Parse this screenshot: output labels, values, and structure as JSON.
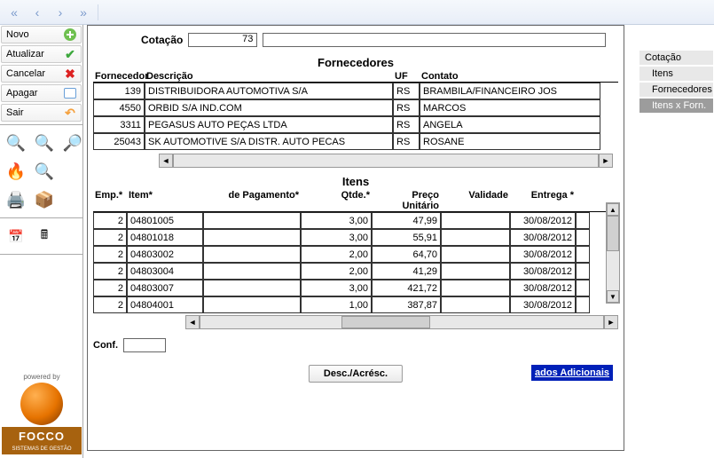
{
  "leftButtons": {
    "novo": "Novo",
    "atualizar": "Atualizar",
    "cancelar": "Cancelar",
    "apagar": "Apagar",
    "sair": "Sair"
  },
  "logo": {
    "poweredBy": "powered by",
    "name": "FOCCO",
    "sub": "SISTEMAS DE GESTÃO"
  },
  "rightMenu": {
    "cotacao": "Cotação",
    "itens": "Itens",
    "fornecedores": "Fornecedores",
    "itensxforn": "Itens x Forn."
  },
  "cotacao": {
    "label": "Cotação",
    "numero": "73"
  },
  "fornecedores": {
    "title": "Fornecedores",
    "headers": {
      "forn": "Fornecedor",
      "desc": "Descrição",
      "uf": "UF",
      "cont": "Contato"
    },
    "rows": [
      {
        "forn": "139",
        "desc": "DISTRIBUIDORA AUTOMOTIVA S/A",
        "uf": "RS",
        "cont": "BRAMBILA/FINANCEIRO JOS"
      },
      {
        "forn": "4550",
        "desc": "ORBID S/A IND.COM",
        "uf": "RS",
        "cont": "MARCOS"
      },
      {
        "forn": "3311",
        "desc": "PEGASUS AUTO PEÇAS LTDA",
        "uf": "RS",
        "cont": "ANGELA"
      },
      {
        "forn": "25043",
        "desc": "SK AUTOMOTIVE S/A DISTR. AUTO PECAS",
        "uf": "RS",
        "cont": "ROSANE"
      }
    ]
  },
  "itens": {
    "title": "Itens",
    "headers": {
      "emp": "Emp.*",
      "item": "Item*",
      "pag": "de Pagamento*",
      "qtde": "Qtde.*",
      "preco": "Preço Unitário",
      "val": "Validade",
      "ent": "Entrega *",
      "extra": ""
    },
    "rows": [
      {
        "emp": "2",
        "item": "04801005",
        "pag": "",
        "qtde": "3,00",
        "preco": "47,99",
        "val": "",
        "ent": "30/08/2012"
      },
      {
        "emp": "2",
        "item": "04801018",
        "pag": "",
        "qtde": "3,00",
        "preco": "55,91",
        "val": "",
        "ent": "30/08/2012"
      },
      {
        "emp": "2",
        "item": "04803002",
        "pag": "",
        "qtde": "2,00",
        "preco": "64,70",
        "val": "",
        "ent": "30/08/2012"
      },
      {
        "emp": "2",
        "item": "04803004",
        "pag": "",
        "qtde": "2,00",
        "preco": "41,29",
        "val": "",
        "ent": "30/08/2012"
      },
      {
        "emp": "2",
        "item": "04803007",
        "pag": "",
        "qtde": "3,00",
        "preco": "421,72",
        "val": "",
        "ent": "30/08/2012"
      },
      {
        "emp": "2",
        "item": "04804001",
        "pag": "",
        "qtde": "1,00",
        "preco": "387,87",
        "val": "",
        "ent": "30/08/2012"
      }
    ]
  },
  "conf": {
    "label": "Conf."
  },
  "buttons": {
    "desc": "Desc./Acrésc.",
    "dados": "ados Adicionais"
  }
}
